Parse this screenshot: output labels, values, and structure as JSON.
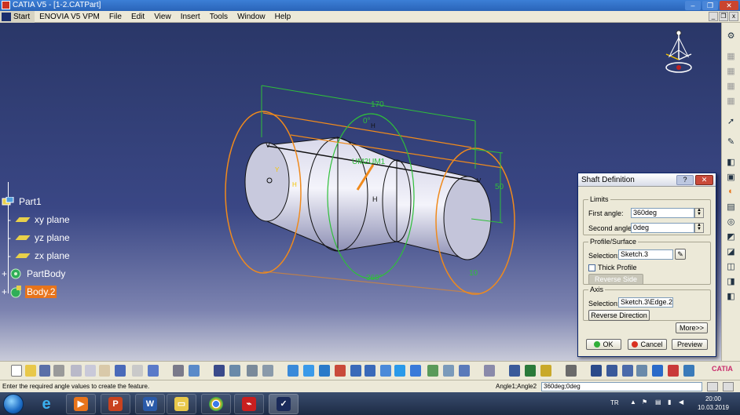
{
  "window": {
    "title": "CATIA V5 - [1-2.CATPart]"
  },
  "menu": {
    "items": [
      "Start",
      "ENOVIA V5 VPM",
      "File",
      "Edit",
      "View",
      "Insert",
      "Tools",
      "Window",
      "Help"
    ]
  },
  "tree": {
    "items": [
      {
        "label": "Part1",
        "icon": "part-icon"
      },
      {
        "label": "xy plane",
        "icon": "plane-icon"
      },
      {
        "label": "yz plane",
        "icon": "plane-icon"
      },
      {
        "label": "zx plane",
        "icon": "plane-icon"
      },
      {
        "label": "PartBody",
        "icon": "body-icon"
      },
      {
        "label": "Body.2",
        "icon": "body-icon",
        "selected": true
      }
    ]
  },
  "model": {
    "dim_length": "170",
    "dim_diameter": "50",
    "dim_end": "10",
    "angle_top": "0°",
    "angle_bottom": "360°",
    "constraint_label": "UM2UM1",
    "marker_v": "V",
    "marker_h": "H",
    "marker_h2": "H",
    "marker_h3": "H",
    "marker_y": "Y",
    "marker_end": "V"
  },
  "dialog": {
    "title": "Shaft Definition",
    "help": "?",
    "limits_legend": "Limits",
    "first_angle_label": "First angle:",
    "first_angle_value": "360deg",
    "second_angle_label": "Second angle:",
    "second_angle_value": "0deg",
    "profile_legend": "Profile/Surface",
    "selection_label": "Selection:",
    "selection_value": "Sketch.3",
    "thick_profile_label": "Thick Profile",
    "reverse_side_label": "Reverse Side",
    "axis_legend": "Axis",
    "axis_selection_label": "Selection:",
    "axis_selection_value": "Sketch.3\\Edge.2",
    "reverse_direction_label": "Reverse Direction",
    "more_label": "More>>",
    "ok_label": "OK",
    "cancel_label": "Cancel",
    "preview_label": "Preview"
  },
  "status": {
    "message": "Enter the required angle values to create the feature.",
    "command_label": "Angle1;Angle2",
    "command_value": "360deg;0deg"
  },
  "taskbar": {
    "apps": [
      "internet-explorer",
      "media-player",
      "powerpoint",
      "word",
      "file-explorer",
      "chrome",
      "acrobat",
      "catia"
    ],
    "lang": "TR",
    "time": "20:00",
    "date": "10.03.2019"
  },
  "colors": {
    "viewport_top": "#2a3768",
    "selection": "#e8741b",
    "dimension": "#2fbf3a",
    "preview": "#f08a1c"
  }
}
